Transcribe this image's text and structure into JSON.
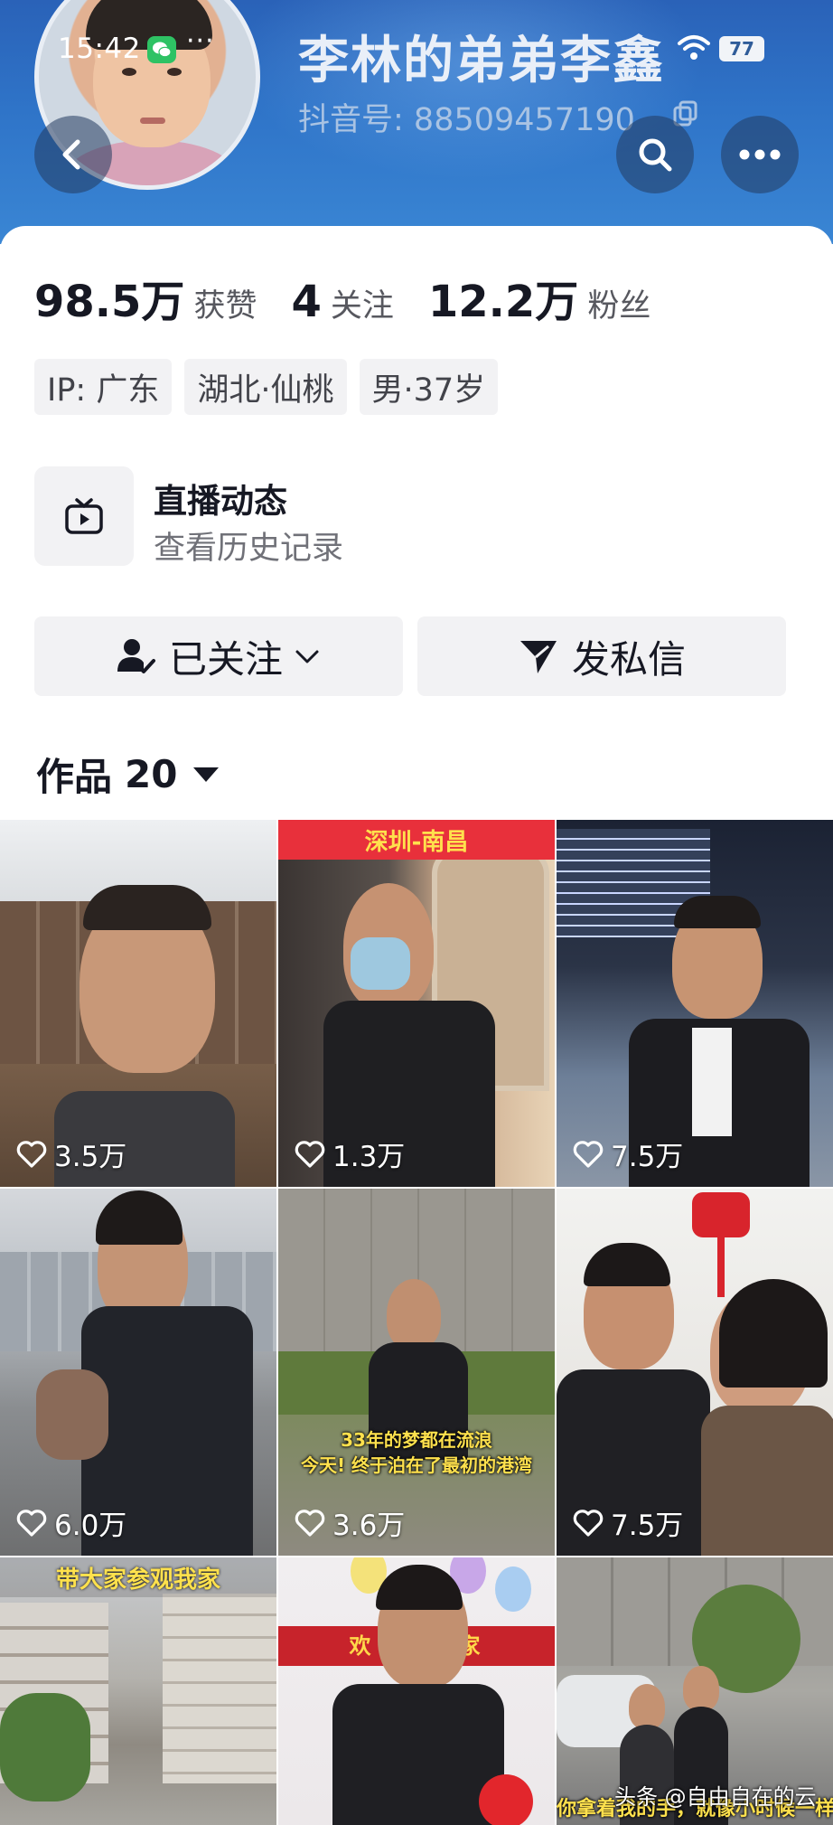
{
  "status_bar": {
    "time": "15:42",
    "more": "···",
    "battery": "77"
  },
  "profile": {
    "nickname": "李林的弟弟李鑫",
    "douyin_id_label": "抖音号: ",
    "douyin_id": "88509457190",
    "stats": [
      {
        "value": "98.5万",
        "label": "获赞"
      },
      {
        "value": "4",
        "label": "关注"
      },
      {
        "value": "12.2万",
        "label": "粉丝"
      }
    ],
    "tags": [
      "IP: 广东",
      "湖北·仙桃",
      "男·37岁"
    ]
  },
  "live": {
    "title": "直播动态",
    "subtitle": "查看历史记录"
  },
  "actions": {
    "follow_label": "已关注",
    "message_label": "发私信"
  },
  "works": {
    "label": "作品",
    "count": "20"
  },
  "videos": [
    {
      "likes": "3.5万"
    },
    {
      "likes": "1.3万",
      "caption": "深圳-南昌"
    },
    {
      "likes": "7.5万"
    },
    {
      "likes": "6.0万"
    },
    {
      "likes": "3.6万",
      "overlay_line1": "33年的梦都在流浪",
      "overlay_line2": "今天! 终于泊在了最初的港湾"
    },
    {
      "likes": "7.5万"
    },
    {
      "caption": "带大家参观我家"
    },
    {
      "banner": "欢 迎 回 家"
    },
    {
      "overlay_line1": "你拿着我的手，就像小时候一样"
    }
  ],
  "watermark": "头条 @自由自在的云",
  "colors": {
    "header": "#2f74c8",
    "accent_red": "#e8303b",
    "wechat": "#2ec264"
  }
}
